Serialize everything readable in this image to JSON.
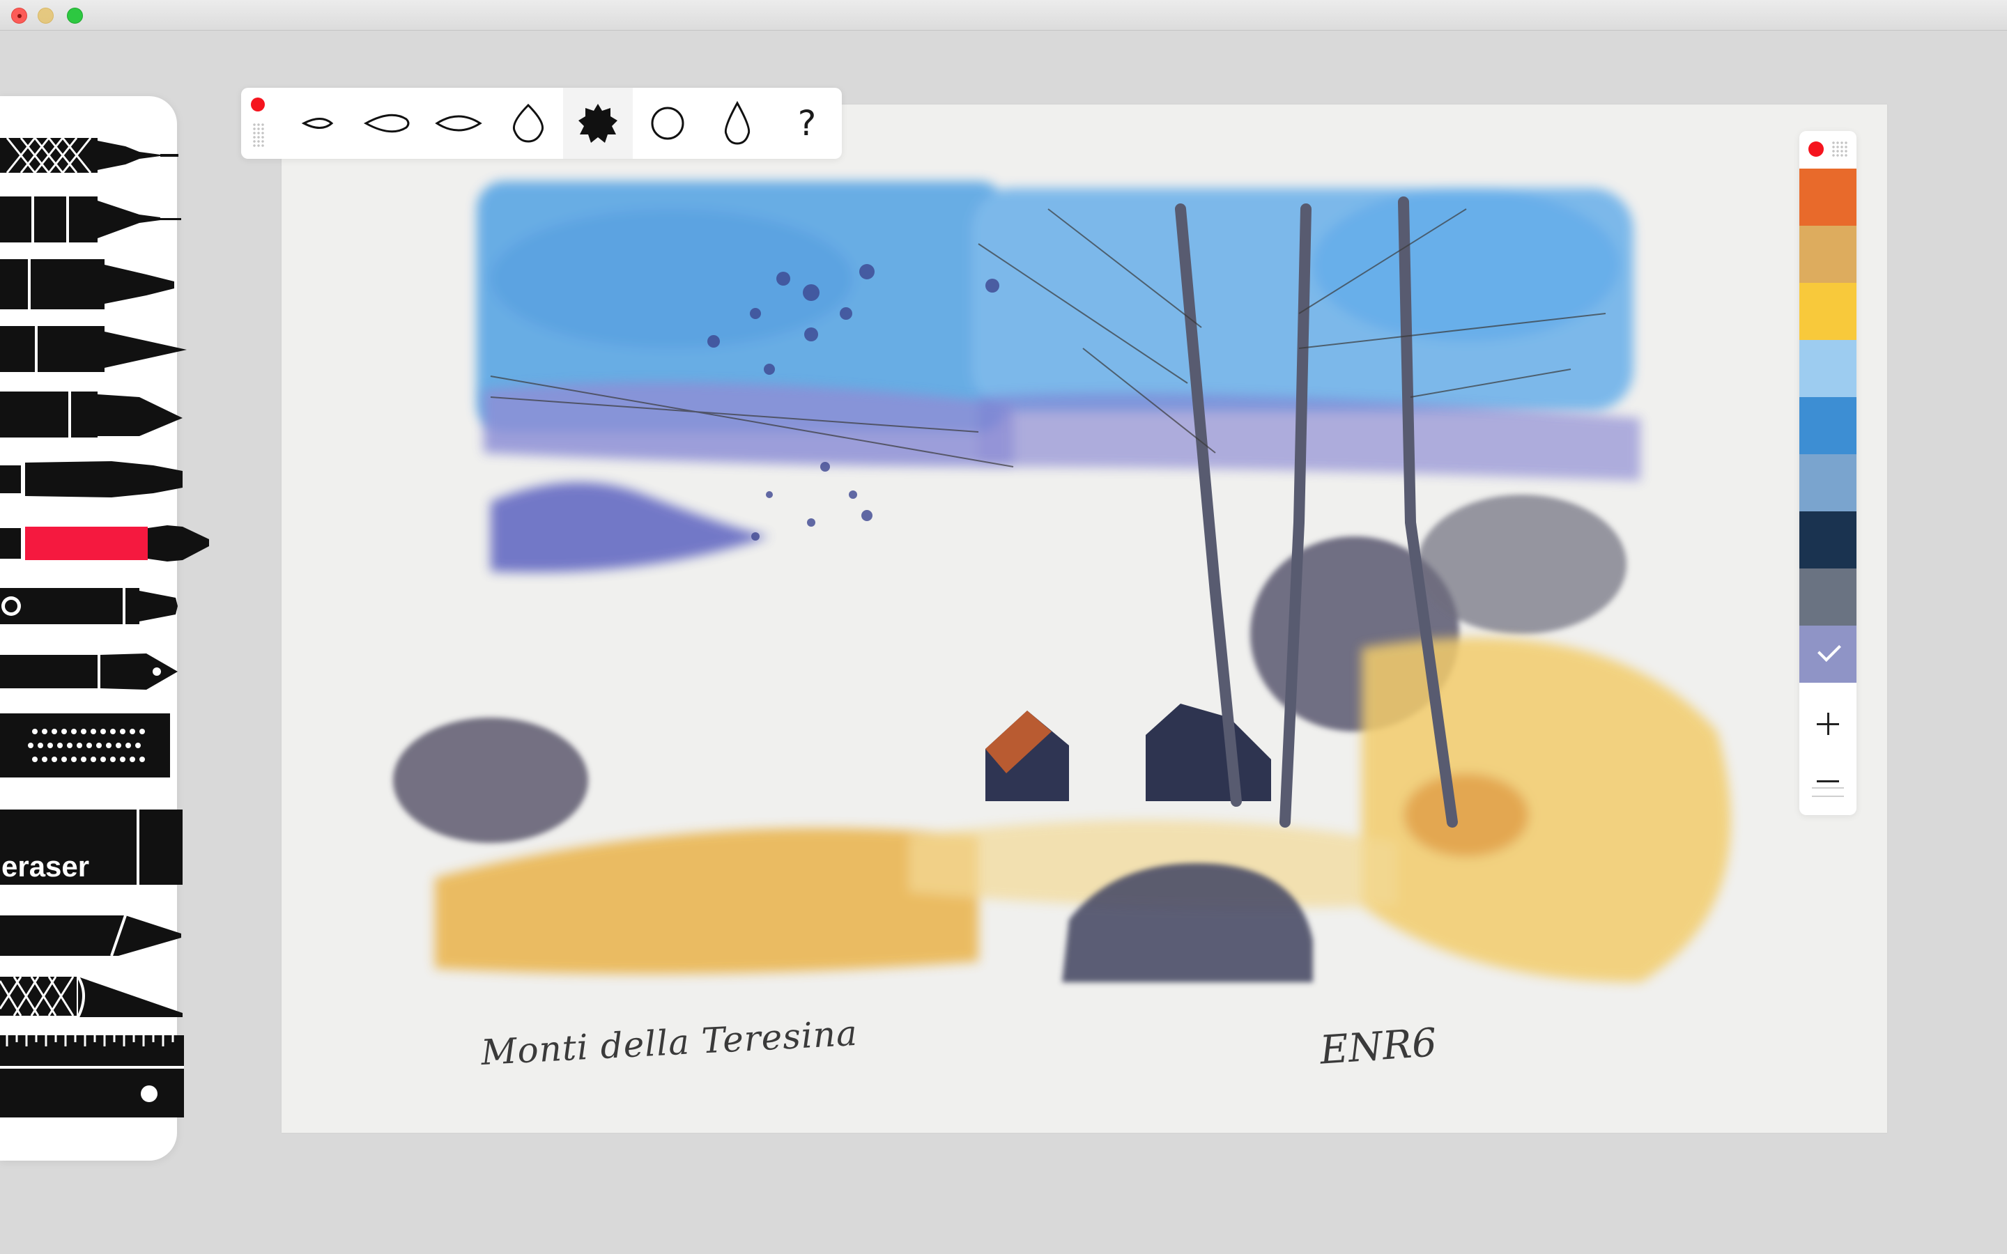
{
  "window": {
    "controls": [
      "close",
      "minimize",
      "maximize"
    ]
  },
  "toolbar": {
    "help_label": "?",
    "brush_shapes": [
      "small-teardrop-icon",
      "teardrop-icon",
      "ellipse-icon",
      "drop-outline-icon",
      "star-blob-icon",
      "circle-icon",
      "raindrop-icon"
    ],
    "active_shape": "star-blob-icon"
  },
  "tools": {
    "eraser_label": "eraser",
    "items": [
      "technical-pen",
      "fineliner",
      "marker",
      "pencil",
      "felt-tip",
      "paint-brush",
      "watercolor-brush",
      "crayon",
      "fountain-pen",
      "airbrush",
      "eraser",
      "chisel-marker",
      "palette-knife",
      "ruler"
    ],
    "active": "watercolor-brush",
    "active_color": "#f5193f"
  },
  "palette": {
    "swatches": [
      "#e86a2b",
      "#ddac5e",
      "#f8c93b",
      "#9dccf0",
      "#3d8ed3",
      "#7aa4ce",
      "#1a3350",
      "#6a7382",
      "#8f94c6"
    ],
    "selected_index": 8
  },
  "canvas": {
    "caption": "Monti della Teresina",
    "signature": "ENR6"
  }
}
